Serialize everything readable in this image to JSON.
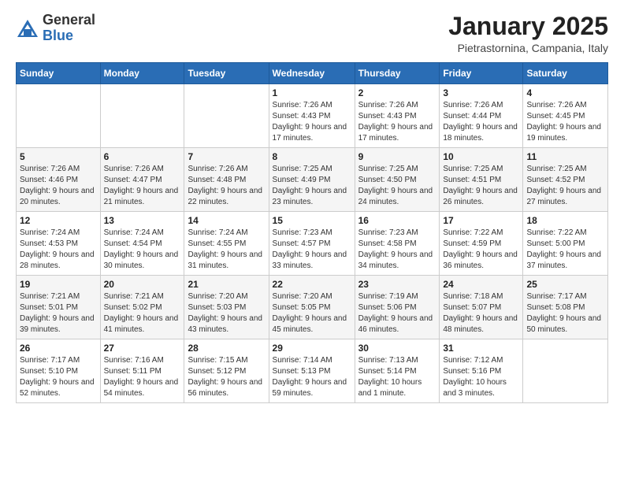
{
  "header": {
    "logo_general": "General",
    "logo_blue": "Blue",
    "month_title": "January 2025",
    "location": "Pietrastornina, Campania, Italy"
  },
  "days_of_week": [
    "Sunday",
    "Monday",
    "Tuesday",
    "Wednesday",
    "Thursday",
    "Friday",
    "Saturday"
  ],
  "weeks": [
    [
      {
        "day": "",
        "sunrise": "",
        "sunset": "",
        "daylight": ""
      },
      {
        "day": "",
        "sunrise": "",
        "sunset": "",
        "daylight": ""
      },
      {
        "day": "",
        "sunrise": "",
        "sunset": "",
        "daylight": ""
      },
      {
        "day": "1",
        "sunrise": "Sunrise: 7:26 AM",
        "sunset": "Sunset: 4:43 PM",
        "daylight": "Daylight: 9 hours and 17 minutes."
      },
      {
        "day": "2",
        "sunrise": "Sunrise: 7:26 AM",
        "sunset": "Sunset: 4:43 PM",
        "daylight": "Daylight: 9 hours and 17 minutes."
      },
      {
        "day": "3",
        "sunrise": "Sunrise: 7:26 AM",
        "sunset": "Sunset: 4:44 PM",
        "daylight": "Daylight: 9 hours and 18 minutes."
      },
      {
        "day": "4",
        "sunrise": "Sunrise: 7:26 AM",
        "sunset": "Sunset: 4:45 PM",
        "daylight": "Daylight: 9 hours and 19 minutes."
      }
    ],
    [
      {
        "day": "5",
        "sunrise": "Sunrise: 7:26 AM",
        "sunset": "Sunset: 4:46 PM",
        "daylight": "Daylight: 9 hours and 20 minutes."
      },
      {
        "day": "6",
        "sunrise": "Sunrise: 7:26 AM",
        "sunset": "Sunset: 4:47 PM",
        "daylight": "Daylight: 9 hours and 21 minutes."
      },
      {
        "day": "7",
        "sunrise": "Sunrise: 7:26 AM",
        "sunset": "Sunset: 4:48 PM",
        "daylight": "Daylight: 9 hours and 22 minutes."
      },
      {
        "day": "8",
        "sunrise": "Sunrise: 7:25 AM",
        "sunset": "Sunset: 4:49 PM",
        "daylight": "Daylight: 9 hours and 23 minutes."
      },
      {
        "day": "9",
        "sunrise": "Sunrise: 7:25 AM",
        "sunset": "Sunset: 4:50 PM",
        "daylight": "Daylight: 9 hours and 24 minutes."
      },
      {
        "day": "10",
        "sunrise": "Sunrise: 7:25 AM",
        "sunset": "Sunset: 4:51 PM",
        "daylight": "Daylight: 9 hours and 26 minutes."
      },
      {
        "day": "11",
        "sunrise": "Sunrise: 7:25 AM",
        "sunset": "Sunset: 4:52 PM",
        "daylight": "Daylight: 9 hours and 27 minutes."
      }
    ],
    [
      {
        "day": "12",
        "sunrise": "Sunrise: 7:24 AM",
        "sunset": "Sunset: 4:53 PM",
        "daylight": "Daylight: 9 hours and 28 minutes."
      },
      {
        "day": "13",
        "sunrise": "Sunrise: 7:24 AM",
        "sunset": "Sunset: 4:54 PM",
        "daylight": "Daylight: 9 hours and 30 minutes."
      },
      {
        "day": "14",
        "sunrise": "Sunrise: 7:24 AM",
        "sunset": "Sunset: 4:55 PM",
        "daylight": "Daylight: 9 hours and 31 minutes."
      },
      {
        "day": "15",
        "sunrise": "Sunrise: 7:23 AM",
        "sunset": "Sunset: 4:57 PM",
        "daylight": "Daylight: 9 hours and 33 minutes."
      },
      {
        "day": "16",
        "sunrise": "Sunrise: 7:23 AM",
        "sunset": "Sunset: 4:58 PM",
        "daylight": "Daylight: 9 hours and 34 minutes."
      },
      {
        "day": "17",
        "sunrise": "Sunrise: 7:22 AM",
        "sunset": "Sunset: 4:59 PM",
        "daylight": "Daylight: 9 hours and 36 minutes."
      },
      {
        "day": "18",
        "sunrise": "Sunrise: 7:22 AM",
        "sunset": "Sunset: 5:00 PM",
        "daylight": "Daylight: 9 hours and 37 minutes."
      }
    ],
    [
      {
        "day": "19",
        "sunrise": "Sunrise: 7:21 AM",
        "sunset": "Sunset: 5:01 PM",
        "daylight": "Daylight: 9 hours and 39 minutes."
      },
      {
        "day": "20",
        "sunrise": "Sunrise: 7:21 AM",
        "sunset": "Sunset: 5:02 PM",
        "daylight": "Daylight: 9 hours and 41 minutes."
      },
      {
        "day": "21",
        "sunrise": "Sunrise: 7:20 AM",
        "sunset": "Sunset: 5:03 PM",
        "daylight": "Daylight: 9 hours and 43 minutes."
      },
      {
        "day": "22",
        "sunrise": "Sunrise: 7:20 AM",
        "sunset": "Sunset: 5:05 PM",
        "daylight": "Daylight: 9 hours and 45 minutes."
      },
      {
        "day": "23",
        "sunrise": "Sunrise: 7:19 AM",
        "sunset": "Sunset: 5:06 PM",
        "daylight": "Daylight: 9 hours and 46 minutes."
      },
      {
        "day": "24",
        "sunrise": "Sunrise: 7:18 AM",
        "sunset": "Sunset: 5:07 PM",
        "daylight": "Daylight: 9 hours and 48 minutes."
      },
      {
        "day": "25",
        "sunrise": "Sunrise: 7:17 AM",
        "sunset": "Sunset: 5:08 PM",
        "daylight": "Daylight: 9 hours and 50 minutes."
      }
    ],
    [
      {
        "day": "26",
        "sunrise": "Sunrise: 7:17 AM",
        "sunset": "Sunset: 5:10 PM",
        "daylight": "Daylight: 9 hours and 52 minutes."
      },
      {
        "day": "27",
        "sunrise": "Sunrise: 7:16 AM",
        "sunset": "Sunset: 5:11 PM",
        "daylight": "Daylight: 9 hours and 54 minutes."
      },
      {
        "day": "28",
        "sunrise": "Sunrise: 7:15 AM",
        "sunset": "Sunset: 5:12 PM",
        "daylight": "Daylight: 9 hours and 56 minutes."
      },
      {
        "day": "29",
        "sunrise": "Sunrise: 7:14 AM",
        "sunset": "Sunset: 5:13 PM",
        "daylight": "Daylight: 9 hours and 59 minutes."
      },
      {
        "day": "30",
        "sunrise": "Sunrise: 7:13 AM",
        "sunset": "Sunset: 5:14 PM",
        "daylight": "Daylight: 10 hours and 1 minute."
      },
      {
        "day": "31",
        "sunrise": "Sunrise: 7:12 AM",
        "sunset": "Sunset: 5:16 PM",
        "daylight": "Daylight: 10 hours and 3 minutes."
      },
      {
        "day": "",
        "sunrise": "",
        "sunset": "",
        "daylight": ""
      }
    ]
  ]
}
